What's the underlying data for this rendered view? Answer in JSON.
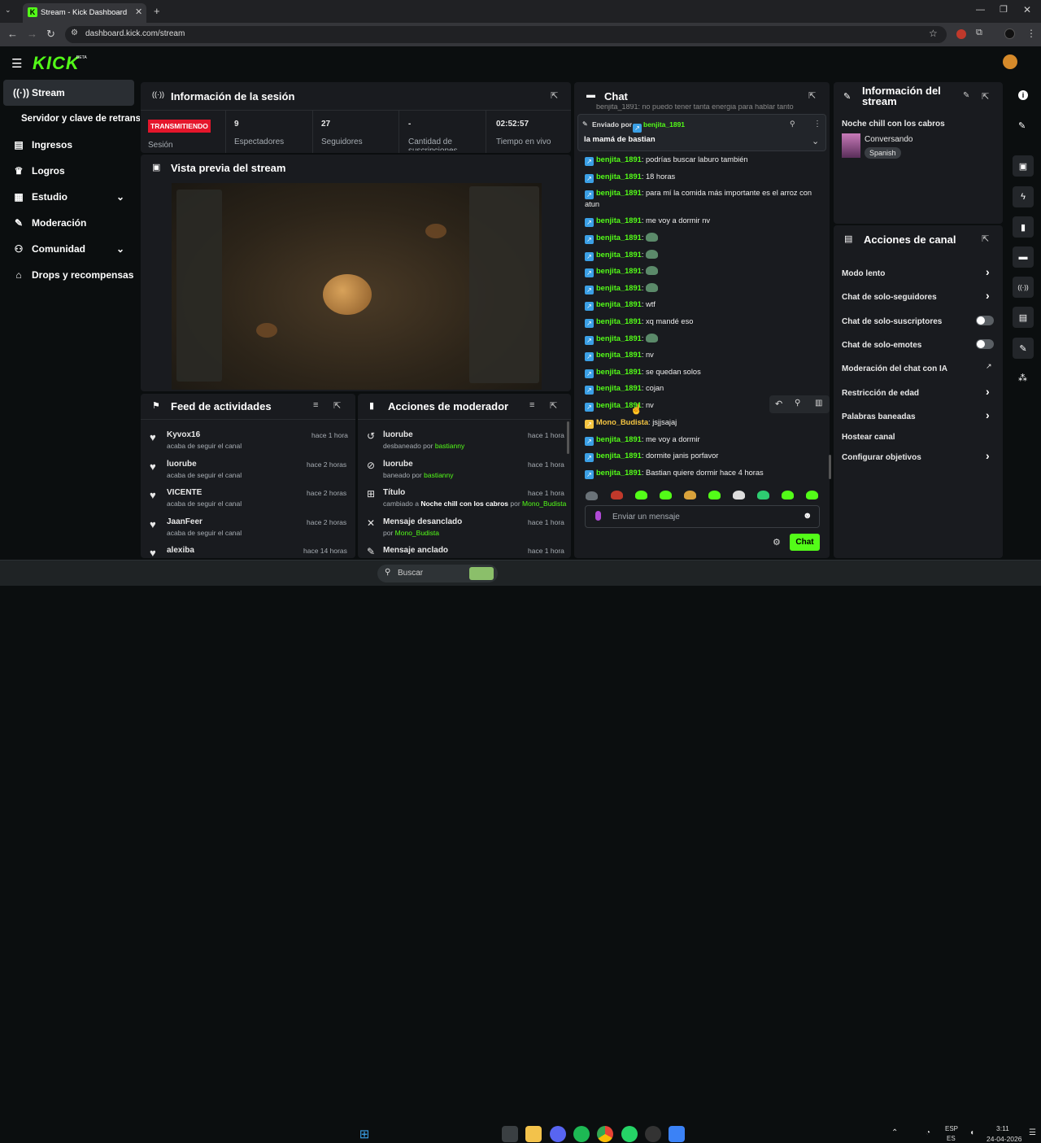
{
  "browser": {
    "tab_title": "Stream - Kick Dashboard",
    "url": "dashboard.kick.com/stream"
  },
  "kick": {
    "logo": "KICK",
    "beta": "BETA"
  },
  "sidebar": {
    "items": [
      {
        "label": "Stream",
        "icon": "broadcast-icon"
      },
      {
        "label": "Servidor y clave de retransn"
      },
      {
        "label": "Ingresos",
        "icon": "money-icon"
      },
      {
        "label": "Logros",
        "icon": "trophy-icon"
      },
      {
        "label": "Estudio",
        "icon": "layout-icon"
      },
      {
        "label": "Moderación",
        "icon": "wrench-icon"
      },
      {
        "label": "Comunidad",
        "icon": "people-icon"
      },
      {
        "label": "Drops y recompensas",
        "icon": "gift-icon"
      }
    ]
  },
  "session": {
    "title": "Información de la sesión",
    "status": "TRANSMITIENDO",
    "status_label": "Sesión",
    "stats": [
      {
        "value": "9",
        "label": "Espectadores"
      },
      {
        "value": "27",
        "label": "Seguidores"
      },
      {
        "value": "-",
        "label": "Cantidad de suscripciones"
      },
      {
        "value": "02:52:57",
        "label": "Tiempo en vivo"
      }
    ]
  },
  "preview": {
    "title": "Vista previa del stream"
  },
  "feed": {
    "title": "Feed de actividades",
    "items": [
      {
        "name": "Kyvox16",
        "desc": "acaba de seguir el canal",
        "time": "hace 1 hora"
      },
      {
        "name": "luorube",
        "desc": "acaba de seguir el canal",
        "time": "hace 2 horas"
      },
      {
        "name": "VICENTE",
        "desc": "acaba de seguir el canal",
        "time": "hace 2 horas"
      },
      {
        "name": "JaanFeer",
        "desc": "acaba de seguir el canal",
        "time": "hace 2 horas"
      },
      {
        "name": "alexiba",
        "desc": "",
        "time": "hace 14 horas"
      }
    ]
  },
  "modactions": {
    "title": "Acciones de moderador",
    "items": [
      {
        "title": "luorube",
        "desc_pre": "desbaneado por ",
        "desc_user": "bastianny",
        "time": "hace 1 hora"
      },
      {
        "title": "luorube",
        "desc_pre": "baneado por ",
        "desc_user": "bastianny",
        "time": "hace 1 hora"
      },
      {
        "title": "Título",
        "desc_pre": "cambiado a ",
        "desc_bold": "Noche chill con los cabros",
        "desc_mid": " por ",
        "desc_user": "Mono_Budista",
        "time": "hace 1 hora"
      },
      {
        "title": "Mensaje desanclado",
        "desc_pre": "por ",
        "desc_user": "Mono_Budista",
        "time": "hace 1 hora"
      },
      {
        "title": "Mensaje anclado",
        "desc_pre": "",
        "desc_user": "",
        "time": "hace 1 hora"
      }
    ]
  },
  "chat": {
    "title": "Chat",
    "top_partial": "benjita_1891: no puedo tener tanta energia para hablar tanto",
    "pinned": {
      "label": "Enviado por",
      "user": "benjita_1891",
      "message": "la mamá de bastian"
    },
    "messages": [
      {
        "user": "benjita_1891",
        "text": "podrías buscar laburo también"
      },
      {
        "user": "benjita_1891",
        "text": "18 horas"
      },
      {
        "user": "benjita_1891",
        "text": "para mí la comida más importante es el arroz con atun"
      },
      {
        "user": "benjita_1891",
        "text": "me voy a dormir nv"
      },
      {
        "user": "benjita_1891",
        "text": "",
        "emote": true
      },
      {
        "user": "benjita_1891",
        "text": "",
        "emote": true
      },
      {
        "user": "benjita_1891",
        "text": "",
        "emote": true
      },
      {
        "user": "benjita_1891",
        "text": "",
        "emote": true
      },
      {
        "user": "benjita_1891",
        "text": "wtf"
      },
      {
        "user": "benjita_1891",
        "text": "xq mandé eso"
      },
      {
        "user": "benjita_1891",
        "text": "",
        "emote": true
      },
      {
        "user": "benjita_1891",
        "text": "nv"
      },
      {
        "user": "benjita_1891",
        "text": "se quedan solos"
      },
      {
        "user": "benjita_1891",
        "text": "cojan"
      },
      {
        "user": "benjita_1891",
        "text": "nv"
      },
      {
        "user": "Mono_Budista",
        "text": "jsjjsajaj",
        "color": "#f5c542"
      },
      {
        "user": "benjita_1891",
        "text": "me voy a dormir"
      },
      {
        "user": "benjita_1891",
        "text": "dormite janis porfavor"
      },
      {
        "user": "benjita_1891",
        "text": "Bastian quiere dormir hace 4 horas"
      }
    ],
    "input_placeholder": "Enviar un mensaje",
    "send_label": "Chat"
  },
  "streaminfo": {
    "title": "Información del stream",
    "stream_title": "Noche chill con los cabros",
    "category": "Conversando",
    "language": "Spanish"
  },
  "channel": {
    "title": "Acciones de canal",
    "actions": [
      {
        "label": "Modo lento",
        "control": "chevron"
      },
      {
        "label": "Chat de solo-seguidores",
        "control": "chevron"
      },
      {
        "label": "Chat de solo-suscriptores",
        "control": "toggle"
      },
      {
        "label": "Chat de solo-emotes",
        "control": "toggle"
      },
      {
        "label": "Moderación del chat con IA",
        "control": "external"
      },
      {
        "label": "Restricción de edad",
        "control": "chevron"
      },
      {
        "label": "Palabras baneadas",
        "control": "chevron"
      },
      {
        "label": "Hostear canal",
        "control": "none"
      },
      {
        "label": "Configurar objetivos",
        "control": "chevron"
      }
    ]
  },
  "taskbar": {
    "search": "Buscar",
    "lang1": "ESP",
    "lang2": "ES",
    "time": "3:11",
    "date": "24-04-2026"
  }
}
